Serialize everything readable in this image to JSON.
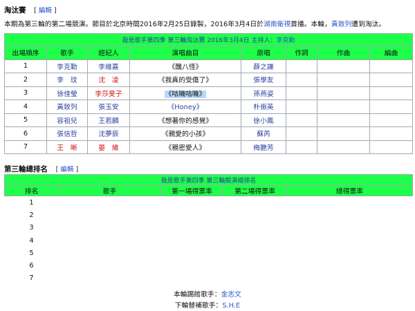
{
  "section1": {
    "title": "淘汰賽",
    "edit_open": "[",
    "edit_label": "編輯",
    "edit_close": "]"
  },
  "intro": {
    "part1": "本期為第三輪的第二場競演。節目於北京時間2016年2月25日錄製，2016年3月4日於",
    "link1": "湖南衛視",
    "part2": "首播。本輪，",
    "link2": "黃致列",
    "part3": "遭到淘汰。"
  },
  "table1": {
    "caption_text": "我是歌手第四季 第三輪淘汰賽 2016年3月4日 主持人：",
    "caption_host": "李克勤",
    "headers": [
      "出場順序",
      "歌手",
      "經紀人",
      "演唱曲目",
      "原唱",
      "作詞",
      "作曲",
      "編曲"
    ],
    "rows": [
      {
        "order": "1",
        "singer": "李克勤",
        "agent": "李維嘉",
        "song": "《醜八怪》",
        "original": "薛之謙"
      },
      {
        "order": "2",
        "singer": "李　玟",
        "agent": "沈　凌",
        "song": "《我真的受傷了》",
        "original": "張學友"
      },
      {
        "order": "3",
        "singer": "徐佳瑩",
        "agent": "李莎旻子",
        "song": "《咕嘰咕嘰》",
        "original": "孫燕姿"
      },
      {
        "order": "4",
        "singer": "黃致列",
        "agent": "張玉安",
        "song": "《Honey》",
        "original": "朴振英"
      },
      {
        "order": "5",
        "singer": "容祖兒",
        "agent": "王若麟",
        "song": "《想著你的感覺》",
        "original": "徐小鳳"
      },
      {
        "order": "6",
        "singer": "張信哲",
        "agent": "沈夢辰",
        "song": "《親愛的小孩》",
        "original": "蘇芮"
      },
      {
        "order": "7",
        "singer": "王　晰",
        "agent": "晏　維",
        "song": "《親密愛人》",
        "original": "梅艷芳"
      }
    ]
  },
  "section2": {
    "title": "第三輪總排名",
    "edit_open": "[",
    "edit_label": "編輯",
    "edit_close": "]"
  },
  "table2": {
    "caption": "我是歌手第四季 第三輪競演總排名",
    "headers": [
      "排名",
      "歌手",
      "第一場得票率",
      "第二場得票率",
      "總得票率"
    ],
    "ranks": [
      "1",
      "2",
      "3",
      "4",
      "5",
      "6",
      "7"
    ]
  },
  "footer": {
    "line1_label": "本輪踢館歌手：",
    "line1_value": "金志文",
    "line2_label": "下輪替補歌手：",
    "line2_value": "S.H.E"
  },
  "colors": {
    "header_green": "#1eff4a",
    "link_blue": "#2a56c6",
    "name_blue": "#2a3f9e",
    "red": "#cc1111",
    "highlight": "#b9d8fb"
  }
}
